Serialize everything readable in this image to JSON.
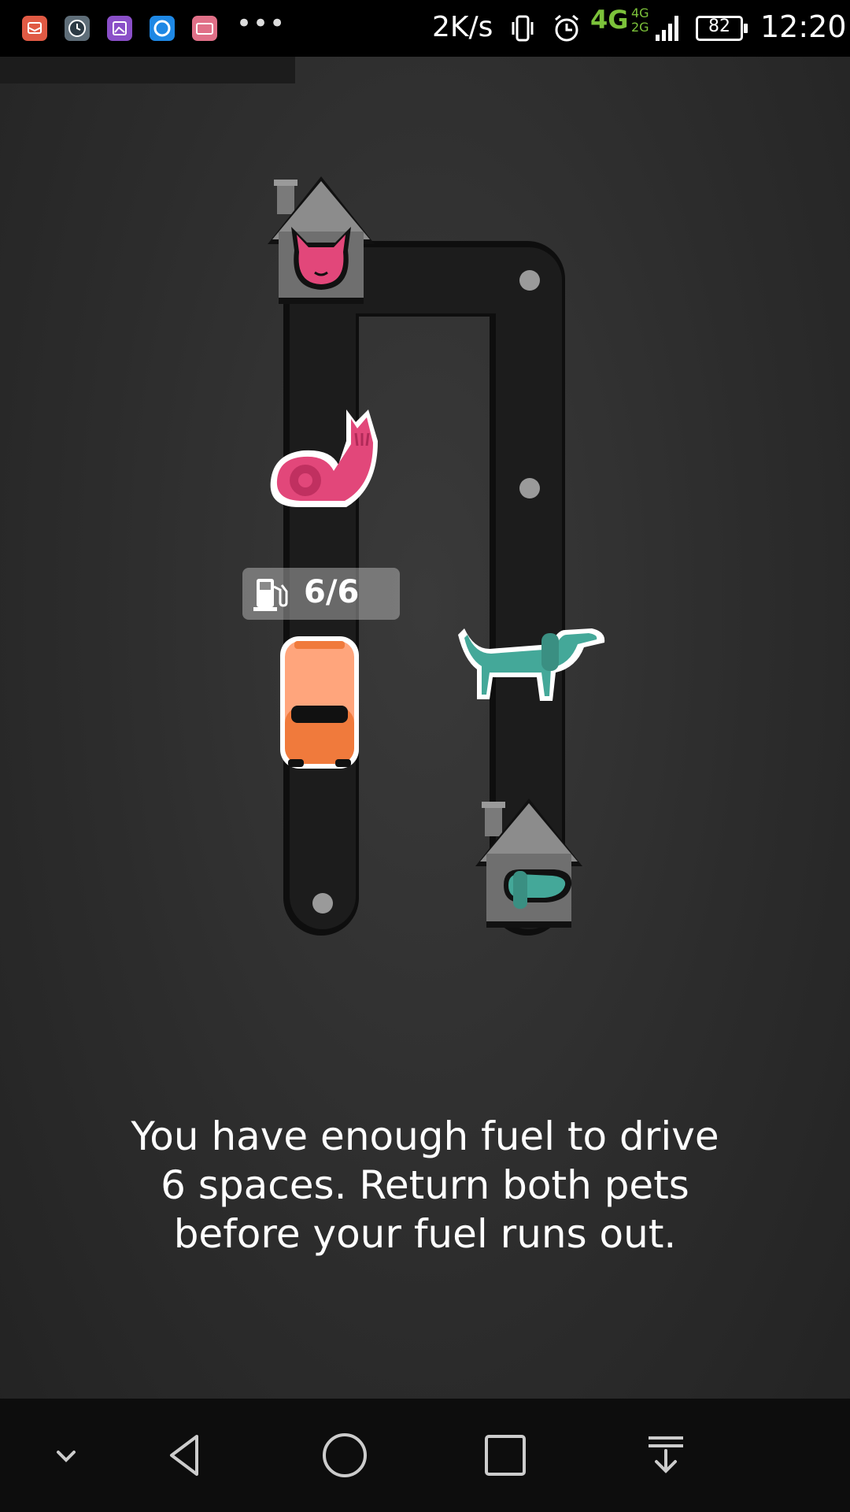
{
  "status_bar": {
    "app_icons": [
      {
        "icon": "mail-app-icon",
        "color": "#e05a44"
      },
      {
        "icon": "clock-app-icon",
        "color": "#5e6d78"
      },
      {
        "icon": "gallery-app-icon",
        "color": "#8a4fc8"
      },
      {
        "icon": "browser-app-icon",
        "color": "#1e88e5"
      },
      {
        "icon": "video-app-icon",
        "color": "#e07088"
      }
    ],
    "more": "•••",
    "net_speed": "2K/s",
    "network": "4G",
    "network_small_top": "4G",
    "network_small_bottom": "2G",
    "battery": "82",
    "time": "12:20"
  },
  "game": {
    "fuel": "6/6",
    "colors": {
      "road": "#1b1b1b",
      "house": "#6f6f6f",
      "house_roof": "#8c8c8c",
      "cat": "#e2477a",
      "dog": "#44a899",
      "car": "#f07a3c"
    },
    "pieces": [
      "cat-house",
      "dog-house",
      "cat",
      "dog",
      "car"
    ]
  },
  "instruction": {
    "line1": "You have enough fuel to drive",
    "line2": "6 spaces. Return both pets",
    "line3": "before your fuel runs out."
  },
  "nav": {
    "buttons": [
      "collapse-icon",
      "back-icon",
      "home-icon",
      "recents-icon",
      "notification-pull-icon"
    ]
  }
}
